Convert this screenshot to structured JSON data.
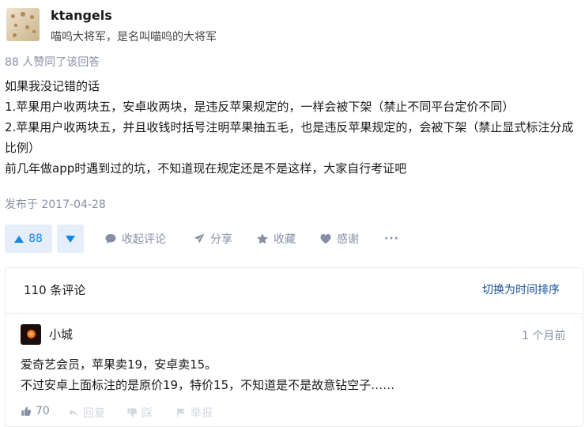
{
  "answer": {
    "author_name": "ktangels",
    "author_bio": "喵呜大将军，是名叫喵呜的大将军",
    "voters_text": "88 人赞同了该回答",
    "paragraphs": [
      "如果我没记错的话",
      "1.苹果用户收两块五，安卓收两块，是违反苹果规定的，一样会被下架（禁止不同平台定价不同）",
      "2.苹果用户收两块五，并且收钱时括号注明苹果抽五毛，也是违反苹果规定的，会被下架（禁止显式标注分成比例）",
      "前几年做app时遇到过的坑，不知道现在规定还是不是这样，大家自行考证吧"
    ],
    "published": "发布于 2017-04-28"
  },
  "actions": {
    "vote_count": "88",
    "collapse_comments": "收起评论",
    "share": "分享",
    "favorite": "收藏",
    "thanks": "感谢",
    "more": "···"
  },
  "comments": {
    "count_label": "110 条评论",
    "sort_toggle": "切换为时间排序",
    "items": [
      {
        "author": "小城",
        "time": "1 个月前",
        "lines": [
          "爱奇艺会员，苹果卖19，安卓卖15。",
          "不过安卓上面标注的是原价19，特价15，不知道是不是故意钻空子……"
        ],
        "likes": "70",
        "reply": "回复",
        "dislike": "踩",
        "report": "举报"
      }
    ]
  },
  "colors": {
    "accent": "#0f88eb",
    "muted": "#8590a6",
    "link": "#175199",
    "vote_bg": "#e5eef9"
  }
}
